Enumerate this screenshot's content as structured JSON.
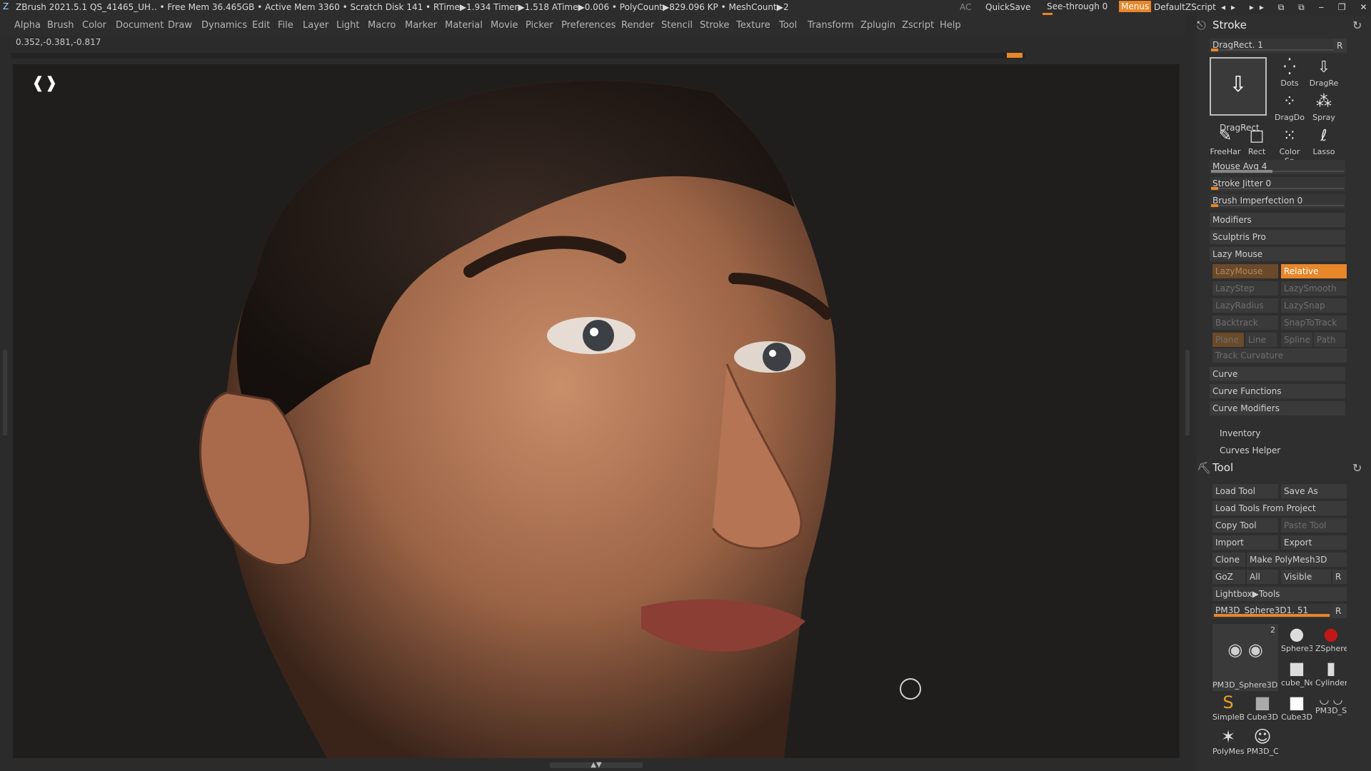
{
  "titlebar": {
    "app": "ZBrush 2021.5.1",
    "doc": "QS_41465_UH",
    "stats": ".. • Free Mem 36.465GB • Active Mem 3360 • Scratch Disk 141 •  RTime▶1.934 Timer▶1.518 ATime▶0.006 • PolyCount▶829.096 KP  • MeshCount▶2",
    "ac": "AC",
    "quicksave": "QuickSave",
    "seethrough": "See-through  0",
    "menus": "Menus",
    "script": "DefaultZScript"
  },
  "menubar": [
    "Alpha",
    "Brush",
    "Color",
    "Document",
    "Draw",
    "Dynamics",
    "Edit",
    "File",
    "Layer",
    "Light",
    "Macro",
    "Marker",
    "Material",
    "Movie",
    "Picker",
    "Preferences",
    "Render",
    "Stencil",
    "Stroke",
    "Texture",
    "Tool",
    "Transform",
    "Zplugin",
    "Zscript",
    "Help"
  ],
  "coords": "0.352,-0.381,-0.817",
  "stroke": {
    "title": "Stroke",
    "dragrect_slider": "DragRect. 1",
    "r": "R",
    "icons": [
      "DragRect",
      "Dots",
      "DragRe",
      "DragDo",
      "Spray",
      "FreeHar",
      "Rect",
      "Color Sp",
      "Lasso"
    ],
    "mouse_avg": "Mouse Avg 4",
    "stroke_jitter": "Stroke Jitter 0",
    "brush_imperfection": "Brush Imperfection 0",
    "modifiers": "Modifiers",
    "sculptris_pro": "Sculptris Pro",
    "lazy_mouse": "Lazy Mouse",
    "lazymouse_btn": "LazyMouse",
    "relative_btn": "Relative",
    "lazystep": "LazyStep",
    "lazysmooth": "LazySmooth",
    "lazyradius": "LazyRadius",
    "lazysnap": "LazySnap",
    "backtrack": "Backtrack",
    "snaptotrack": "SnapToTrack",
    "plane": "Plane",
    "line": "Line",
    "spline": "Spline",
    "path": "Path",
    "track_curvature": "Track Curvature",
    "curve": "Curve",
    "curve_functions": "Curve Functions",
    "curve_modifiers": "Curve Modifiers",
    "inventory": "Inventory",
    "curves_helper": "Curves Helper"
  },
  "tool": {
    "title": "Tool",
    "load_tool": "Load Tool",
    "save_as": "Save As",
    "load_from_project": "Load Tools From Project",
    "copy_tool": "Copy Tool",
    "paste_tool": "Paste Tool",
    "import": "Import",
    "export": "Export",
    "clone": "Clone",
    "make_polymesh": "Make PolyMesh3D",
    "goz": "GoZ",
    "all": "All",
    "visible": "Visible",
    "r": "R",
    "lightbox": "Lightbox▶Tools",
    "current_tool": "PM3D_Sphere3D1. 51",
    "count": "2",
    "thumbs": [
      "PM3D_Sphere3D",
      "Sphere3",
      "ZSphere",
      "cube_Ne",
      "Cylinder",
      "SimpleB",
      "Cube3D",
      "Cube3D",
      "PM3D_S",
      "PolyMes",
      "PM3D_C"
    ]
  }
}
